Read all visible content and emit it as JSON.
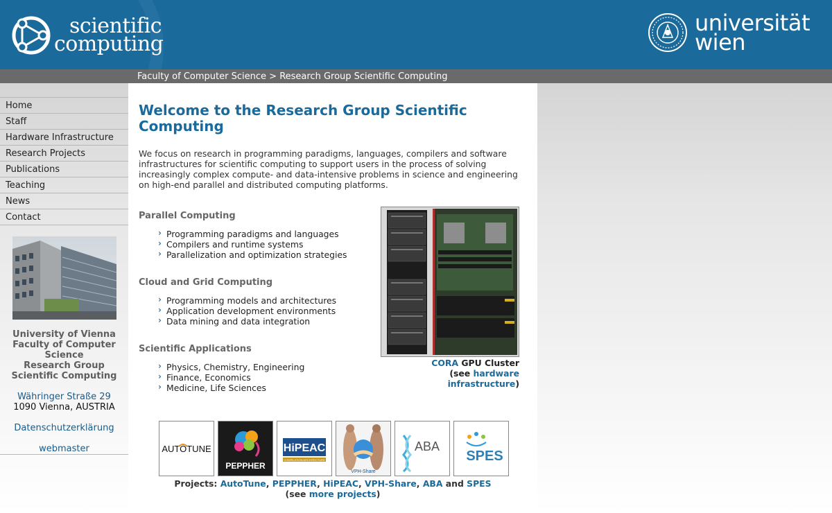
{
  "header": {
    "brand_line1": "scientific",
    "brand_line2": "computing",
    "uni_line1": "universität",
    "uni_line2": "wien",
    "bg_color": "#1a6a9c"
  },
  "breadcrumb": {
    "item1": "Faculty of Computer Science",
    "separator": ">",
    "item2": "Research Group Scientific Computing"
  },
  "nav": {
    "items": [
      "Home",
      "Staff",
      "Hardware Infrastructure",
      "Research Projects",
      "Publications",
      "Teaching",
      "News",
      "Contact"
    ]
  },
  "address": {
    "line1": "University of Vienna",
    "line2": "Faculty of Computer Science",
    "line3": "Research Group Scientific Computing",
    "street": "Währinger Straße 29",
    "city": "1090 Vienna, AUSTRIA",
    "privacy": "Datenschutzerklärung",
    "webmaster": "webmaster"
  },
  "main": {
    "title": "Welcome to the Research Group Scientific Computing",
    "intro": "We focus on research in programming paradigms, languages, compilers and software infrastructures for scientific computing to support users in the process of solving increasingly complex compute- and data-intensive problems in science and engineering on high-end parallel and distributed computing platforms.",
    "sections": [
      {
        "title": "Parallel Computing",
        "items": [
          "Programming paradigms and languages",
          "Compilers and runtime systems",
          "Parallelization and optimization strategies"
        ]
      },
      {
        "title": "Cloud and Grid Computing",
        "items": [
          "Programming models and architectures",
          "Application development environments",
          "Data mining and data integration"
        ]
      },
      {
        "title": "Scientific Applications",
        "items": [
          "Physics, Chemistry, Engineering",
          "Finance, Economics",
          "Medicine, Life Sciences"
        ]
      }
    ]
  },
  "cluster": {
    "link": "CORA",
    "text": "GPU Cluster",
    "see_open": "(see",
    "see_link": "hardware infrastructure",
    "see_close": ")"
  },
  "projects": {
    "logos": [
      "AUTOTUNE",
      "PEPPHER",
      "HiPEAC",
      "VPH-Share",
      "ABA",
      "SPES"
    ],
    "prefix": "Projects:",
    "p1": "AutoTune",
    "p2": "PEPPHER",
    "p3": "HiPEAC",
    "p4": "VPH-Share",
    "p5": "ABA",
    "and": "and",
    "p6": "SPES",
    "see_open": "(see",
    "see_link": "more projects",
    "see_close": ")",
    "hipeac_sub": "COMPILATION ARCHITECTURE"
  },
  "colors": {
    "accent": "#1a6a9c",
    "crumb_bar": "#6a6a6a",
    "link": "#1a5a86"
  }
}
